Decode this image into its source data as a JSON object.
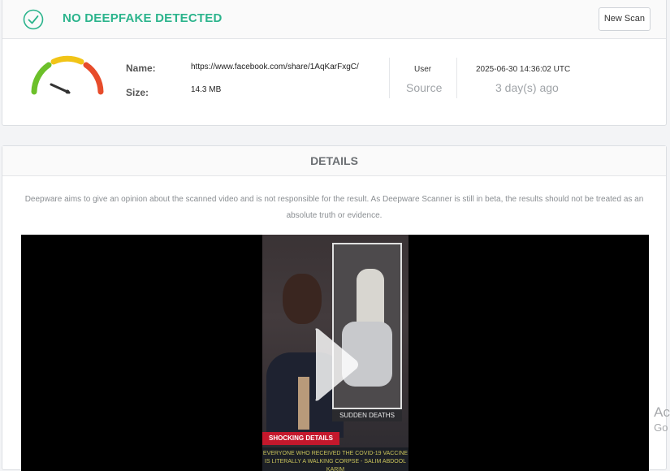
{
  "result": {
    "status_title": "NO DEEPFAKE DETECTED",
    "new_scan_label": "New Scan",
    "name_label": "Name:",
    "name_value": "https://www.facebook.com/share/1AqKarFxgC/",
    "size_label": "Size:",
    "size_value": "14.3 MB",
    "source_type": "User",
    "source_label": "Source",
    "scan_datetime": "2025-06-30 14:36:02 UTC",
    "scan_age": "3 day(s) ago"
  },
  "details": {
    "title": "DETAILS",
    "disclaimer": "Deepware aims to give an opinion about the scanned video and is not responsible for the result. As Deepware Scanner is still in beta, the results should not be treated as an absolute truth or evidence."
  },
  "video": {
    "inset_caption": "SUDDEN DEATHS",
    "banner_text": "SHOCKING DETAILS",
    "ticker_text": "EVERYONE WHO RECEIVED THE COVID-19 VACCINE IS LITERALLY A WALKING CORPSE - SALIM ABDOOL KARIM"
  },
  "watermark": {
    "line1": "Ac",
    "line2": "Go"
  },
  "colors": {
    "success": "#2bb48c",
    "gauge_green": "#6cc02a",
    "gauge_yellow": "#f1c417",
    "gauge_red": "#e74c2b",
    "banner_red": "#c4182c"
  },
  "icons": {
    "status": "check-circle-icon",
    "meter": "gauge-icon",
    "video": "play-icon"
  }
}
